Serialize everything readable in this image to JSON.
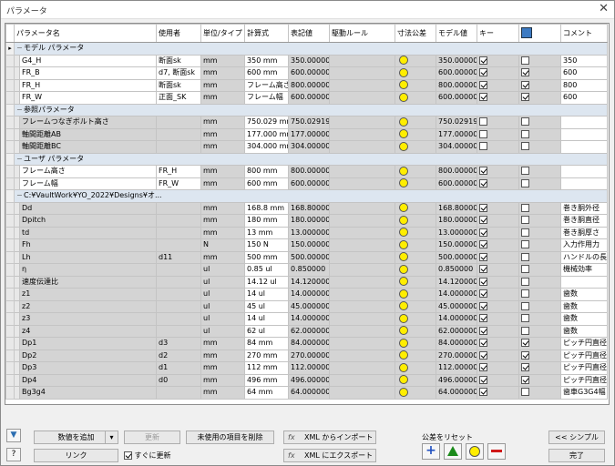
{
  "window": {
    "title": "パラメータ",
    "close_glyph": "✕"
  },
  "columns": {
    "name": "パラメータ名",
    "consumer": "使用者",
    "unit": "単位/タイプ",
    "equation": "計算式",
    "nominal": "表記値",
    "driving": "駆動ルール",
    "tolerance": "寸法公差",
    "model": "モデル値",
    "key": "キー",
    "comment": "コメント"
  },
  "rows": [
    {
      "type": "group",
      "name": "モデル パラメータ",
      "tree": "−",
      "sel": true
    },
    {
      "name": "G4_H",
      "consumer": "断面sk",
      "unit": "mm",
      "eq": "350 mm",
      "nom": "350.000000",
      "tol": true,
      "model": "350.000000",
      "key": true,
      "exp": false,
      "comment": "350",
      "white": true
    },
    {
      "name": "FR_B",
      "consumer": "d7, 断面sk",
      "unit": "mm",
      "eq": "600 mm",
      "nom": "600.000000",
      "tol": true,
      "model": "600.000000",
      "key": true,
      "exp": true,
      "comment": "600",
      "white": true
    },
    {
      "name": "FR_H",
      "consumer": "断面sk",
      "unit": "mm",
      "eq": "フレーム高さ",
      "nom": "800.000000",
      "tol": true,
      "model": "800.000000",
      "key": true,
      "exp": true,
      "comment": "800",
      "white": true
    },
    {
      "name": "FR_W",
      "consumer": "正面_SK",
      "unit": "mm",
      "eq": "フレーム幅",
      "nom": "600.000000",
      "tol": true,
      "model": "600.000000",
      "key": true,
      "exp": true,
      "comment": "600",
      "white": true
    },
    {
      "type": "group",
      "name": "参照パラメータ",
      "tree": "−"
    },
    {
      "name": "フレームつなぎボルト高さ",
      "consumer": "",
      "unit": "mm",
      "eq": "750.029 mm",
      "nom": "750.029193",
      "tol": true,
      "model": "750.029193",
      "key": false,
      "exp": false,
      "comment": ""
    },
    {
      "name": "軸間距離AB",
      "consumer": "",
      "unit": "mm",
      "eq": "177.000 mm",
      "nom": "177.000000",
      "tol": true,
      "model": "177.000000",
      "key": false,
      "exp": false,
      "comment": ""
    },
    {
      "name": "軸間距離BC",
      "consumer": "",
      "unit": "mm",
      "eq": "304.000 mm",
      "nom": "304.000000",
      "tol": true,
      "model": "304.000000",
      "key": false,
      "exp": false,
      "comment": ""
    },
    {
      "type": "group",
      "name": "ユーザ パラメータ",
      "tree": "−"
    },
    {
      "name": "フレーム高さ",
      "consumer": "FR_H",
      "unit": "mm",
      "eq": "800 mm",
      "nom": "800.000000",
      "tol": true,
      "model": "800.000000",
      "key": true,
      "exp": false,
      "comment": "",
      "white": true
    },
    {
      "name": "フレーム幅",
      "consumer": "FR_W",
      "unit": "mm",
      "eq": "600 mm",
      "nom": "600.000000",
      "tol": true,
      "model": "600.000000",
      "key": true,
      "exp": false,
      "comment": "",
      "white": true
    },
    {
      "type": "group",
      "name": "C:¥VaultWork¥YO_2022¥Designs¥オ...",
      "tree": "−"
    },
    {
      "name": "Dd",
      "consumer": "",
      "unit": "mm",
      "eq": "168.8 mm",
      "nom": "168.800000",
      "tol": true,
      "model": "168.800000",
      "key": true,
      "exp": false,
      "comment": "巻き胴外径"
    },
    {
      "name": "Dpitch",
      "consumer": "",
      "unit": "mm",
      "eq": "180 mm",
      "nom": "180.000000",
      "tol": true,
      "model": "180.000000",
      "key": true,
      "exp": false,
      "comment": "巻き胴直径"
    },
    {
      "name": "td",
      "consumer": "",
      "unit": "mm",
      "eq": "13 mm",
      "nom": "13.000000",
      "tol": true,
      "model": "13.000000",
      "key": true,
      "exp": false,
      "comment": "巻き胴厚さ"
    },
    {
      "name": "Fh",
      "consumer": "",
      "unit": "N",
      "eq": "150 N",
      "nom": "150.000000",
      "tol": true,
      "model": "150.000000",
      "key": true,
      "exp": false,
      "comment": "入力作用力"
    },
    {
      "name": "Lh",
      "consumer": "d11",
      "unit": "mm",
      "eq": "500 mm",
      "nom": "500.000000",
      "tol": true,
      "model": "500.000000",
      "key": true,
      "exp": false,
      "comment": "ハンドルの長さ"
    },
    {
      "name": "η",
      "consumer": "",
      "unit": "ul",
      "eq": "0.85 ul",
      "nom": "0.850000",
      "tol": true,
      "model": "0.850000",
      "key": true,
      "exp": false,
      "comment": "機械効率"
    },
    {
      "name": "速度伝達比",
      "consumer": "",
      "unit": "ul",
      "eq": "14.12 ul",
      "nom": "14.120000",
      "tol": true,
      "model": "14.120000",
      "key": true,
      "exp": false,
      "comment": ""
    },
    {
      "name": "z1",
      "consumer": "",
      "unit": "ul",
      "eq": "14 ul",
      "nom": "14.000000",
      "tol": true,
      "model": "14.000000",
      "key": true,
      "exp": false,
      "comment": "歯数"
    },
    {
      "name": "z2",
      "consumer": "",
      "unit": "ul",
      "eq": "45 ul",
      "nom": "45.000000",
      "tol": true,
      "model": "45.000000",
      "key": true,
      "exp": false,
      "comment": "歯数"
    },
    {
      "name": "z3",
      "consumer": "",
      "unit": "ul",
      "eq": "14 ul",
      "nom": "14.000000",
      "tol": true,
      "model": "14.000000",
      "key": true,
      "exp": false,
      "comment": "歯数"
    },
    {
      "name": "z4",
      "consumer": "",
      "unit": "ul",
      "eq": "62 ul",
      "nom": "62.000000",
      "tol": true,
      "model": "62.000000",
      "key": true,
      "exp": false,
      "comment": "歯数"
    },
    {
      "name": "Dp1",
      "consumer": "d3",
      "unit": "mm",
      "eq": "84 mm",
      "nom": "84.000000",
      "tol": true,
      "model": "84.000000",
      "key": true,
      "exp": true,
      "comment": "ピッチ円直径"
    },
    {
      "name": "Dp2",
      "consumer": "d2",
      "unit": "mm",
      "eq": "270 mm",
      "nom": "270.000000",
      "tol": true,
      "model": "270.000000",
      "key": true,
      "exp": true,
      "comment": "ピッチ円直径"
    },
    {
      "name": "Dp3",
      "consumer": "d1",
      "unit": "mm",
      "eq": "112 mm",
      "nom": "112.000000",
      "tol": true,
      "model": "112.000000",
      "key": true,
      "exp": true,
      "comment": "ピッチ円直径"
    },
    {
      "name": "Dp4",
      "consumer": "d0",
      "unit": "mm",
      "eq": "496 mm",
      "nom": "496.000000",
      "tol": true,
      "model": "496.000000",
      "key": true,
      "exp": true,
      "comment": "ピッチ円直径"
    },
    {
      "name": "Bg3g4",
      "consumer": "",
      "unit": "mm",
      "eq": "64 mm",
      "nom": "64.000000",
      "tol": true,
      "model": "64.000000",
      "key": true,
      "exp": false,
      "comment": "歯車G3G4幅"
    }
  ],
  "buttons": {
    "add": "数値を追加",
    "update": "更新",
    "purge": "未使用の項目を削除",
    "xml_import": "XML からインポート",
    "link": "リンク",
    "immediate": "すぐに更新",
    "xml_export": "XML にエクスポート",
    "tol_reset": "公差をリセット",
    "less": "<< シンプル",
    "done": "完了"
  },
  "icons": {
    "xml": "fx",
    "filter": "filter-icon",
    "help": "?"
  }
}
